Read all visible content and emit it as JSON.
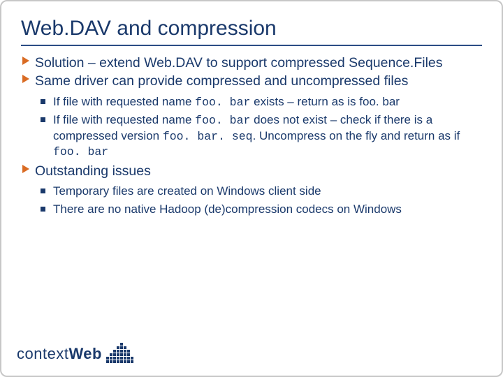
{
  "title": "Web.DAV and compression",
  "bullets": {
    "b1": "Solution – extend Web.DAV to support compressed Sequence.Files",
    "b2": "Same driver can provide compressed and uncompressed files",
    "b2_sub1_a": "If file with requested name ",
    "b2_sub1_code1": "foo. bar",
    "b2_sub1_b": " exists – return as is foo. bar",
    "b2_sub2_a": "If file with requested name ",
    "b2_sub2_code1": "foo. bar",
    "b2_sub2_b": " does not exist – check if there is a compressed version ",
    "b2_sub2_code2": "foo. bar. seq",
    "b2_sub2_c": ". Uncompress on the fly and return as if ",
    "b2_sub2_code3": "foo. bar",
    "b3": "Outstanding issues",
    "b3_sub1": "Temporary files are created on Windows client side",
    "b3_sub2": "There are no native Hadoop (de)compression codecs on Windows"
  },
  "logo": {
    "context": "context",
    "web": "Web"
  }
}
